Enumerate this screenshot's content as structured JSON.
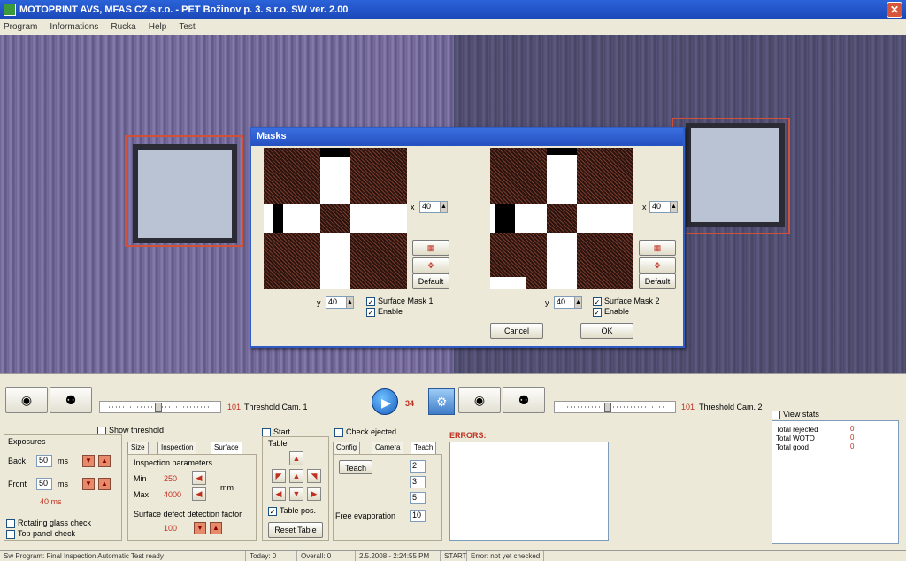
{
  "window": {
    "title": "MOTOPRINT AVS, MFAS CZ s.r.o. - PET Božinov p. 3. s.r.o.  SW ver. 2.00"
  },
  "menu": [
    "Program",
    "Informations",
    "Rucka",
    "Help",
    "Test"
  ],
  "dialog": {
    "title": "Masks",
    "mask1": {
      "x_value": "40",
      "y_value": "40",
      "surface_label": "Surface Mask 1",
      "enable_label": "Enable"
    },
    "mask2": {
      "x_value": "40",
      "y_value": "40",
      "surface_label": "Surface Mask 2",
      "enable_label": "Enable"
    },
    "default_label": "Default",
    "cancel_label": "Cancel",
    "ok_label": "OK",
    "x_label": "x",
    "y_label": "y"
  },
  "toolbar": {
    "threshold1_label": "Threshold Cam. 1",
    "threshold1_value": "101",
    "threshold2_label": "Threshold Cam. 2",
    "threshold2_value": "101",
    "play_value": "34"
  },
  "left_panel": {
    "show_threshold": "Show threshold",
    "exposures": "Exposures",
    "back_label": "Back",
    "back_value": "50",
    "back_unit": "ms",
    "front_label": "Front",
    "front_value": "50",
    "front_unit": "ms",
    "speed": "40 ms",
    "opt1": "Rotating glass check",
    "opt2": "Top panel check"
  },
  "mid_panel": {
    "tabs": [
      "Size",
      "Inspection",
      "Surface"
    ],
    "section1": "Inspection parameters",
    "min_label": "Min",
    "min_value": "250",
    "max_label": "Max",
    "max_value": "4000",
    "unit": "mm",
    "section2": "Surface defect detection factor",
    "factor_value": "100"
  },
  "table_panel": {
    "start": "Start",
    "title": "Table",
    "table_pos": "Table pos.",
    "reset": "Reset Table"
  },
  "right_panel": {
    "check_label": "Check ejected",
    "tabs": [
      "Config",
      "Camera",
      "Teach"
    ],
    "teach_btn": "Teach",
    "row1": "2",
    "row2": "3",
    "row3": "5",
    "field_label": "Free evaporation",
    "field_value": "10"
  },
  "errors": {
    "title": "ERRORS:"
  },
  "stats": {
    "view_title": "View stats",
    "rows": [
      {
        "label": "Total rejected",
        "value": "0"
      },
      {
        "label": "Total WOTO",
        "value": "0"
      },
      {
        "label": "Total good",
        "value": "0"
      }
    ]
  },
  "status": [
    "Sw Program: Final Inspection Automatic Test ready",
    "Today: 0",
    "Overall: 0",
    "2.5.2008  -  2:24:55 PM",
    "START",
    "Error: not yet checked"
  ]
}
